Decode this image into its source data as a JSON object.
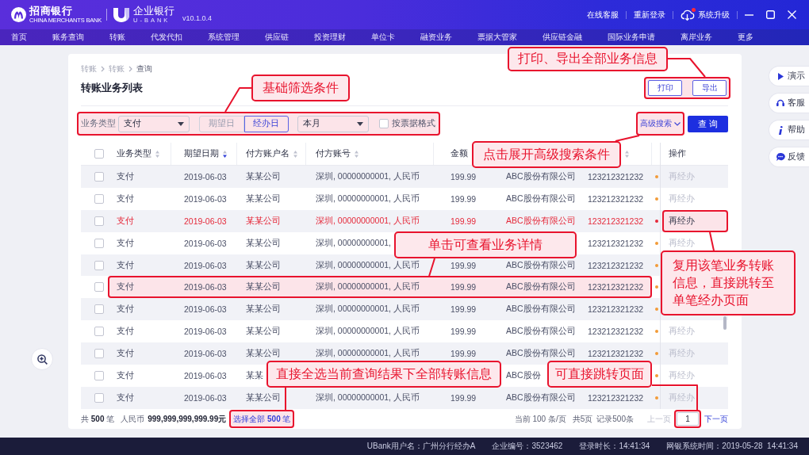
{
  "app": {
    "brand": "招商银行",
    "brand_en": "CHINA MERCHANTS BANK",
    "product": "企业银行",
    "product_en": "U-BANK",
    "version": "v10.1.0.4"
  },
  "top_links": [
    {
      "label": "在线客服",
      "kind": "link",
      "badge": false
    },
    {
      "label": "重新登录",
      "kind": "link",
      "badge": false
    },
    {
      "label": "系统升级",
      "kind": "upgrade",
      "badge": true
    }
  ],
  "nav": [
    "首页",
    "账务查询",
    "转账",
    "代发代扣",
    "系统管理",
    "供应链",
    "投资理财",
    "单位卡",
    "融资业务",
    "票据大管家",
    "供应链金融",
    "国际业务申请",
    "离岸业务",
    "更多"
  ],
  "breadcrumb": [
    "转账",
    "转账",
    "查询"
  ],
  "page_title": "转账业务列表",
  "toolbar": {
    "annotated": true,
    "buttons": [
      "打印",
      "导出"
    ]
  },
  "filters": {
    "annotated": true,
    "type_label": "业务类型",
    "type_value": "支付",
    "date_modes": [
      {
        "label": "期望日",
        "selected": false
      },
      {
        "label": "经办日",
        "selected": true
      }
    ],
    "period": "本月",
    "voucher_format": {
      "label": "按票据格式",
      "checked": false
    }
  },
  "advanced_search": {
    "label": "高级搜索",
    "annotated": true
  },
  "query_button": "查 询",
  "table": {
    "all_checked": false,
    "columns": [
      {
        "label": "业务类型",
        "sorted": false
      },
      {
        "label": "期望日期",
        "sorted": true
      },
      {
        "label": "付方账户名",
        "sorted": false
      },
      {
        "label": "付方账号",
        "sorted": false
      },
      {
        "label": "金额"
      },
      null,
      {
        "sorted": false
      },
      null
    ],
    "action_column": "操作",
    "rows": [
      {
        "checked": false,
        "error": false,
        "annotated": false,
        "action_annotated": false,
        "cells": [
          "支付",
          "2019-06-03",
          "某某公司",
          "深圳, 00000000001, 人民币",
          "199.99",
          "ABC股份有限公司",
          "123212321232"
        ],
        "color": "#f29b38",
        "action": "再经办",
        "action_disabled": true
      },
      {
        "checked": false,
        "error": false,
        "annotated": false,
        "action_annotated": false,
        "cells": [
          "支付",
          "2019-06-03",
          "某某公司",
          "深圳, 00000000001, 人民币",
          "199.99",
          "ABC股份有限公司",
          "123212321232"
        ],
        "color": "#f29b38",
        "action": "再经办",
        "action_disabled": true
      },
      {
        "checked": false,
        "error": true,
        "annotated": false,
        "action_annotated": true,
        "cells": [
          "支付",
          "2019-06-03",
          "某某公司",
          "深圳, 00000000001, 人民币",
          "199.99",
          "ABC股份有限公司",
          "123212321232"
        ],
        "color": "#e5293a",
        "action": "再经办",
        "action_disabled": false
      },
      {
        "checked": false,
        "error": false,
        "annotated": false,
        "action_annotated": false,
        "cells": [
          "支付",
          "2019-06-03",
          "某某公司",
          "深圳, 00000000001,",
          null,
          null,
          "123212321232"
        ],
        "color": "#f29b38",
        "action": "再经办",
        "action_disabled": true
      },
      {
        "checked": false,
        "error": false,
        "annotated": false,
        "action_annotated": false,
        "cells": [
          "支付",
          "2019-06-03",
          "某某公司",
          "深圳, 00000000001, 人民币",
          "199.99",
          "ABC股份有限公司",
          "123212321232"
        ],
        "color": "#f29b38"
      },
      {
        "checked": false,
        "error": false,
        "annotated": true,
        "action_annotated": false,
        "cells": [
          "支付",
          "2019-06-03",
          "某某公司",
          "深圳, 00000000001, 人民币",
          "199.99",
          "ABC股份有限公司",
          "123212321232"
        ],
        "color": "#f29b38"
      },
      {
        "checked": false,
        "error": false,
        "annotated": false,
        "action_annotated": false,
        "cells": [
          "支付",
          "2019-06-03",
          "某某公司",
          "深圳, 00000000001, 人民币",
          "199.99",
          "ABC股份有限公司",
          "123212321232"
        ],
        "color": "#f29b38"
      },
      {
        "checked": false,
        "error": false,
        "annotated": false,
        "action_annotated": false,
        "cells": [
          "支付",
          "2019-06-03",
          "某某公司",
          "深圳, 00000000001, 人民币",
          "199.99",
          "ABC股份有限公司",
          "123212321232"
        ],
        "color": "#f29b38",
        "action": "再经办",
        "action_disabled": true
      },
      {
        "checked": false,
        "error": false,
        "annotated": false,
        "action_annotated": false,
        "cells": [
          "支付",
          "2019-06-03",
          "某某公司",
          "深圳, 00000000001, 人民币",
          "199.99",
          "ABC股份有限公司",
          "123212321232"
        ],
        "color": "#f29b38",
        "action": "再经办",
        "action_disabled": true
      },
      {
        "checked": false,
        "error": false,
        "annotated": false,
        "action_annotated": false,
        "cells": [
          "支付",
          "2019-06-03",
          "某某",
          null,
          null,
          "ABC股份",
          null
        ],
        "color": "#f29b38",
        "action": "再经办",
        "action_disabled": true
      },
      {
        "checked": false,
        "error": false,
        "annotated": false,
        "action_annotated": false,
        "cells": [
          "支付",
          "2019-06-03",
          "某某公司",
          "深圳, 00000000001, 人民币",
          "199.99",
          "ABC股份有限公司",
          "123212321232"
        ],
        "color": "#f29b38",
        "action": "再经办",
        "action_disabled": true
      }
    ]
  },
  "footer": {
    "total": "共 **500** 笔",
    "currency": "人民币",
    "amount": "999,999,999,999.99元",
    "select_all": {
      "text": "选择全部 **500** 笔",
      "annotated": true
    },
    "page_size": "当前 100 条/页",
    "pages": "共5页",
    "records": "记录500条",
    "prev": {
      "label": "上一页",
      "disabled": true
    },
    "page_input": {
      "value": "1",
      "annotated": true
    },
    "next": {
      "label": "下一页",
      "disabled": false
    }
  },
  "status_bar": [
    "UBank用户名：广州分行经办A",
    "企业编号：3523462",
    "登录时长：14:41:34",
    "网银系统时间：2019-05-28  14:41:34"
  ],
  "side_actions": [
    {
      "label": "演示",
      "kind": "demo"
    },
    {
      "label": "客服",
      "kind": "service"
    },
    {
      "label": "帮助",
      "kind": "help"
    },
    {
      "label": "反馈",
      "kind": "feedback"
    }
  ],
  "callouts": [
    "打印、导出全部业务信息",
    "基础筛选条件",
    "点击展开高级搜索条件",
    "单击可查看业务详情",
    "复用该笔业务转账信息，直接跳转至单笔经办页面",
    "直接全选当前查询结果下全部转账信息",
    "可直接跳转页面"
  ]
}
